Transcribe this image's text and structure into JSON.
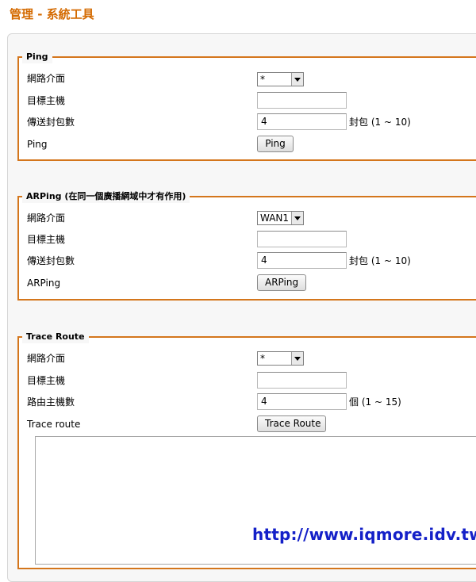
{
  "page": {
    "title": "管理 - 系統工具"
  },
  "ping": {
    "legend": "Ping",
    "interface_label": "網路介面",
    "interface_value": "*",
    "host_label": "目標主機",
    "host_value": "",
    "count_label": "傳送封包數",
    "count_value": "4",
    "count_suffix": "封包 (1 ~ 10)",
    "action_label": "Ping",
    "button_label": "Ping"
  },
  "arping": {
    "legend": "ARPing (在同一個廣播網域中才有作用)",
    "interface_label": "網路介面",
    "interface_value": "WAN1",
    "host_label": "目標主機",
    "host_value": "",
    "count_label": "傳送封包數",
    "count_value": "4",
    "count_suffix": "封包 (1 ~ 10)",
    "action_label": "ARPing",
    "button_label": "ARPing"
  },
  "traceroute": {
    "legend": "Trace Route",
    "interface_label": "網路介面",
    "interface_value": "*",
    "host_label": "目標主機",
    "host_value": "",
    "hops_label": "路由主機數",
    "hops_value": "4",
    "hops_suffix": "個 (1 ~ 15)",
    "action_label": "Trace route",
    "button_label": "Trace Route",
    "output": ""
  },
  "watermark": "http://www.iqmore.idv.tw",
  "colors": {
    "title": "#d46a00",
    "group_border": "#d4761c",
    "watermark": "#1420c8"
  }
}
